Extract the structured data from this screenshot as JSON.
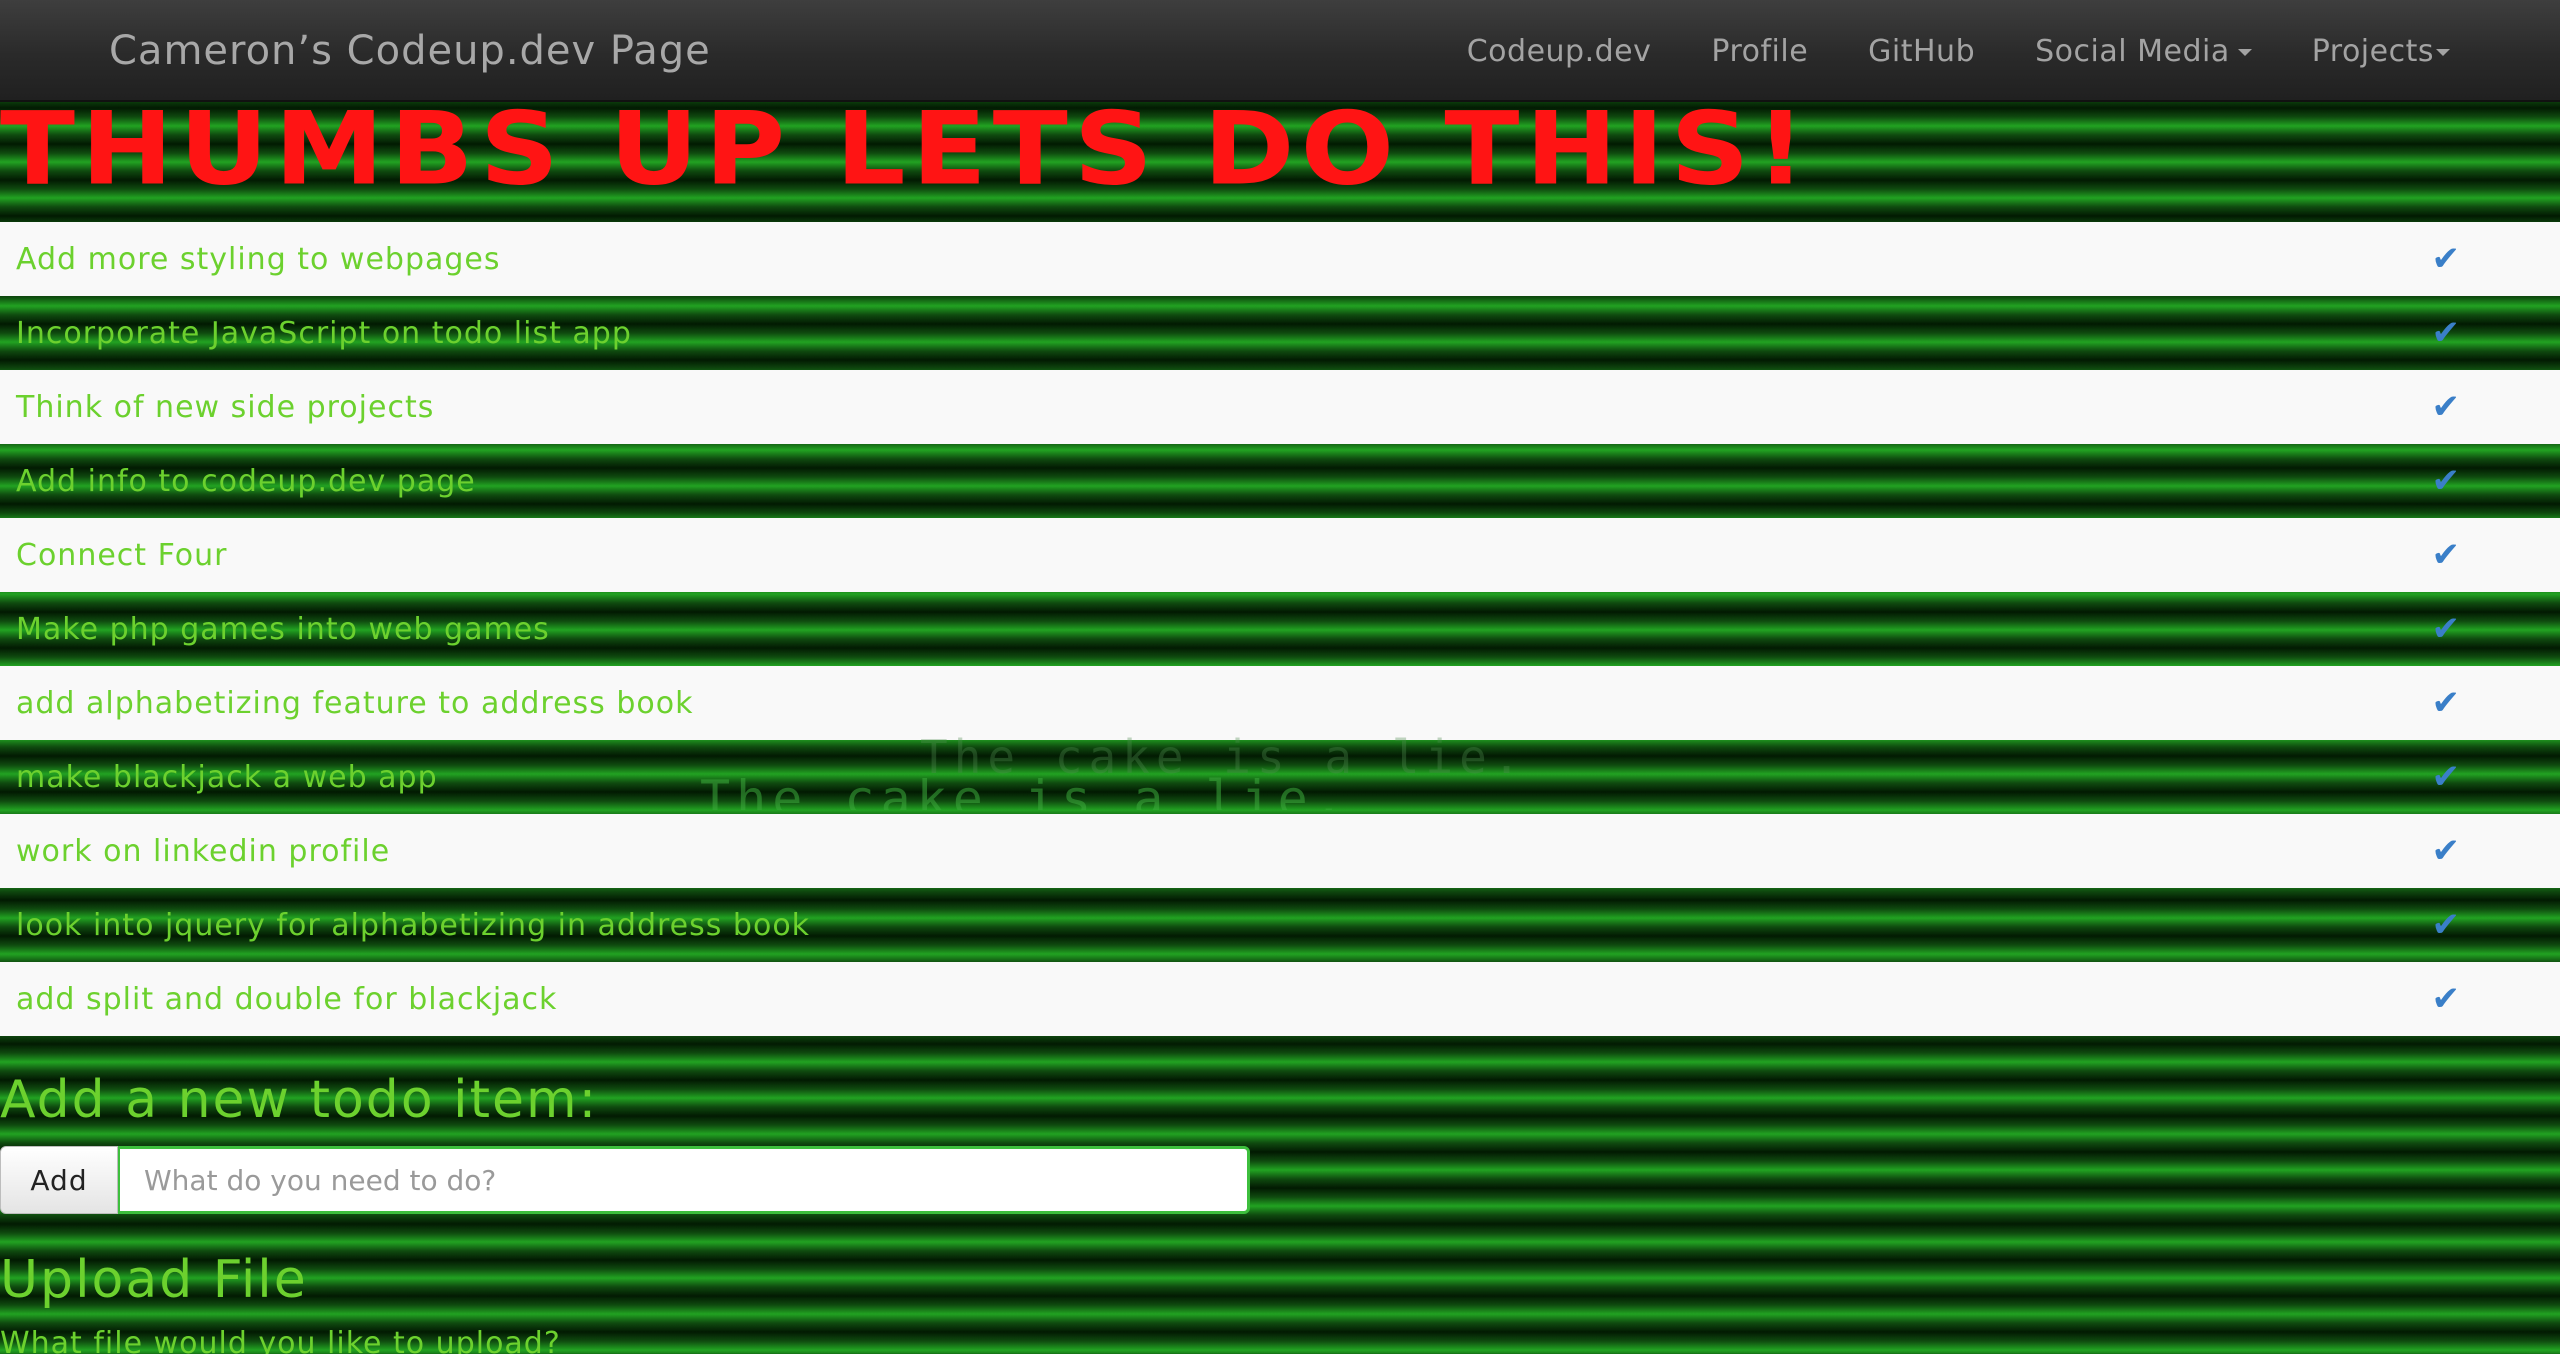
{
  "navbar": {
    "brand": "Cameron’s Codeup.dev Page",
    "items": [
      {
        "label": "Codeup.dev",
        "dropdown": false
      },
      {
        "label": "Profile",
        "dropdown": false
      },
      {
        "label": "GitHub",
        "dropdown": false
      },
      {
        "label": "Social Media",
        "dropdown": true
      },
      {
        "label": "Projects",
        "dropdown": true
      }
    ]
  },
  "headline": "THUMBS UP LETS DO THIS!",
  "todos": [
    {
      "text": "Add more styling to webpages",
      "check": "✔"
    },
    {
      "text": "Incorporate JavaScript on todo list app",
      "check": "✔"
    },
    {
      "text": "Think of new side projects",
      "check": "✔"
    },
    {
      "text": "Add info to codeup.dev page",
      "check": "✔"
    },
    {
      "text": "Connect Four",
      "check": "✔"
    },
    {
      "text": "Make php games into web games",
      "check": "✔"
    },
    {
      "text": "add alphabetizing feature to address book",
      "check": "✔"
    },
    {
      "text": "make blackjack a web app",
      "check": "✔"
    },
    {
      "text": "work on linkedin profile",
      "check": "✔"
    },
    {
      "text": "look into jquery for alphabetizing in address book",
      "check": "✔"
    },
    {
      "text": "add split and double for blackjack",
      "check": "✔"
    }
  ],
  "background_text": {
    "line1": "The cake is a lie.",
    "line2": "The cake is a lie."
  },
  "add_section": {
    "heading": "Add a new todo item:",
    "button_label": "Add",
    "input_placeholder": "What do you need to do?",
    "input_value": ""
  },
  "upload_section": {
    "heading": "Upload File",
    "question": "What file would you like to upload?"
  },
  "colors": {
    "accent_green": "#6cd12e",
    "headline_red": "#ff1414",
    "check_blue": "#3a7fc8",
    "navbar_text": "#a3a3a3"
  },
  "icons": {
    "check": "check-icon",
    "caret": "caret-down-icon"
  }
}
